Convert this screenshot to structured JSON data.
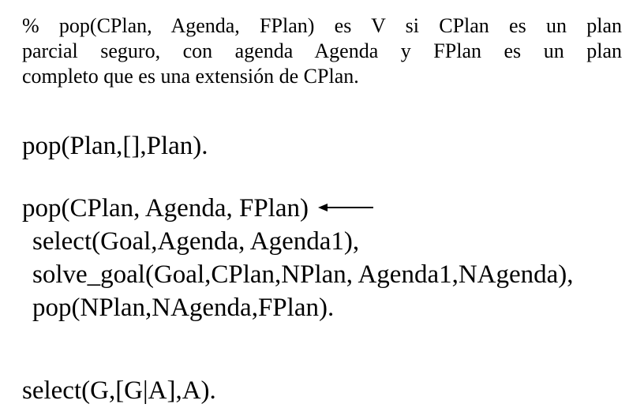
{
  "comment": {
    "lines": [
      "% pop(CPlan, Agenda, FPlan) es V si CPlan es un plan",
      "parcial seguro, con agenda Agenda y FPlan es un plan",
      "completo que es una extensión de CPlan."
    ]
  },
  "clause1": "pop(Plan,[],Plan).",
  "clause2": {
    "head": "pop(CPlan, Agenda, FPlan)",
    "arrow_icon": "left-arrow-icon",
    "body": [
      "select(Goal,Agenda, Agenda1),",
      "solve_goal(Goal,CPlan,NPlan, Agenda1,NAgenda),",
      "pop(NPlan,NAgenda,FPlan)."
    ]
  },
  "clause3": "select(G,[G|A],A)."
}
